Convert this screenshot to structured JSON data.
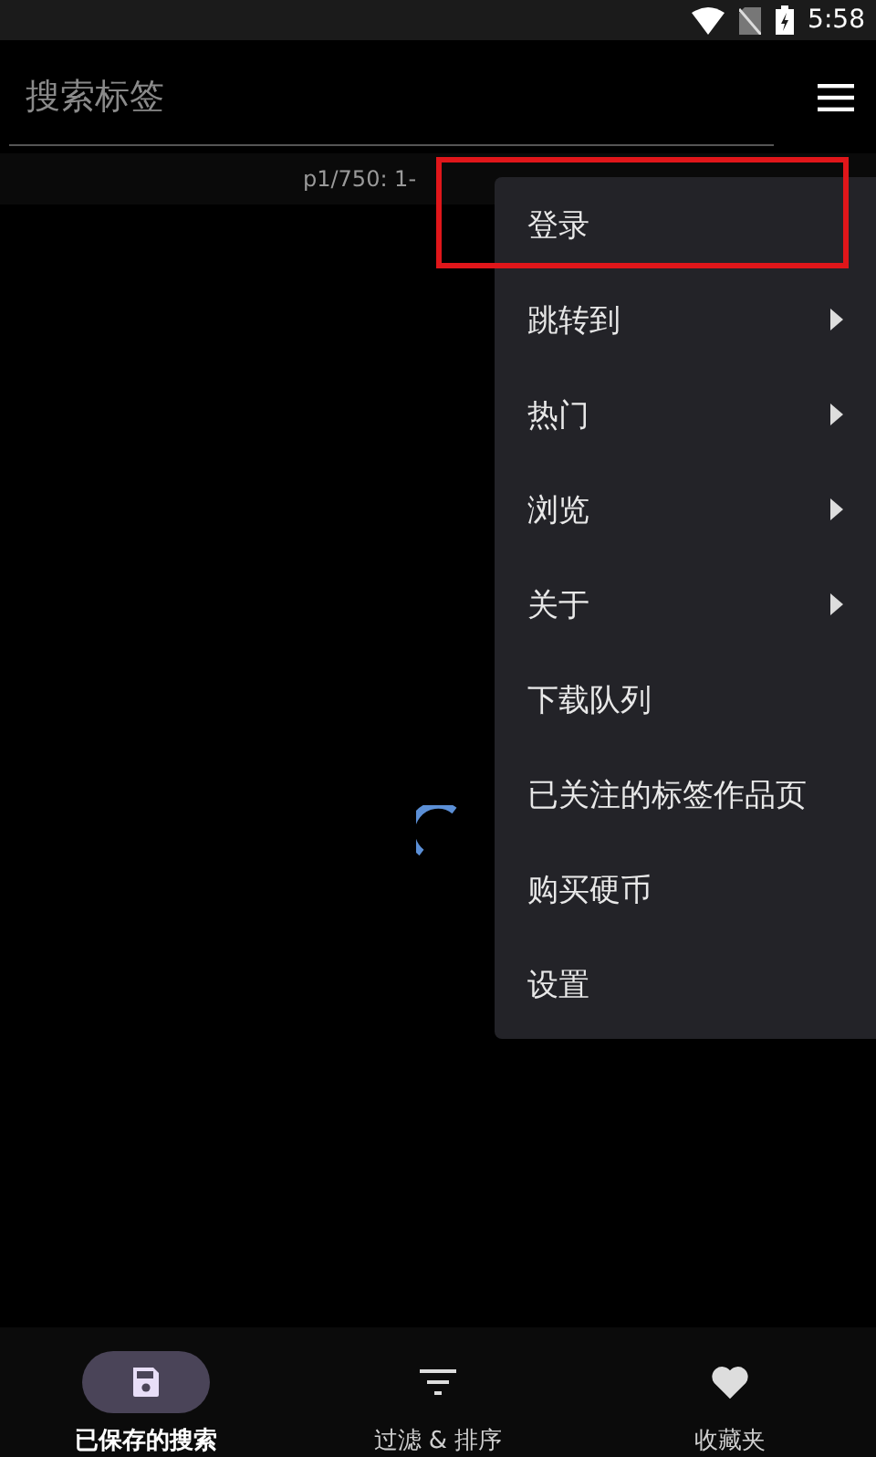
{
  "status_bar": {
    "time": "5:58"
  },
  "search": {
    "placeholder": "搜索标签"
  },
  "page_info": "p1/750: 1-",
  "loading": true,
  "menu": {
    "items": [
      {
        "label": "登录",
        "submenu": false,
        "highlighted": true
      },
      {
        "label": "跳转到",
        "submenu": true,
        "highlighted": false
      },
      {
        "label": "热门",
        "submenu": true,
        "highlighted": false
      },
      {
        "label": "浏览",
        "submenu": true,
        "highlighted": false
      },
      {
        "label": "关于",
        "submenu": true,
        "highlighted": false
      },
      {
        "label": "下载队列",
        "submenu": false,
        "highlighted": false
      },
      {
        "label": "已关注的标签作品页",
        "submenu": false,
        "highlighted": false
      },
      {
        "label": "购买硬币",
        "submenu": false,
        "highlighted": false
      },
      {
        "label": "设置",
        "submenu": false,
        "highlighted": false
      }
    ]
  },
  "bottom_nav": [
    {
      "label": "已保存的搜索",
      "selected": true
    },
    {
      "label": "过滤 & 排序",
      "selected": false
    },
    {
      "label": "收藏夹",
      "selected": false
    }
  ]
}
